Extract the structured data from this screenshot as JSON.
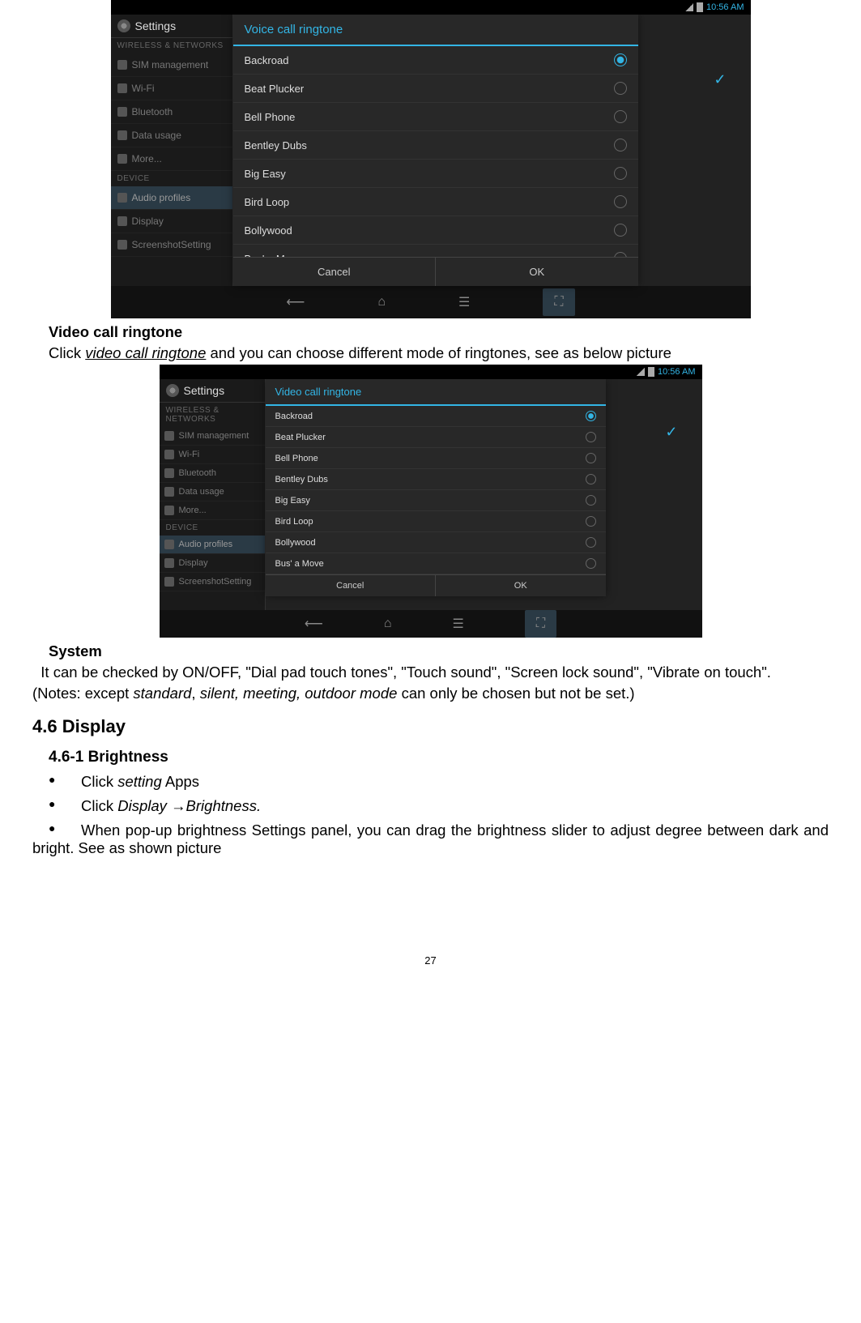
{
  "screenshot_common": {
    "statusbar_time": "10:56 AM",
    "settings_title": "Settings",
    "sidebar_section1": "WIRELESS & NETWORKS",
    "sidebar_items_net": [
      "SIM management",
      "Wi-Fi",
      "Bluetooth",
      "Data usage",
      "More..."
    ],
    "sidebar_section2": "DEVICE",
    "sidebar_items_dev": [
      "Audio profiles",
      "Display",
      "ScreenshotSetting"
    ],
    "ringtone_options": [
      "Backroad",
      "Beat Plucker",
      "Bell Phone",
      "Bentley Dubs",
      "Big Easy",
      "Bird Loop",
      "Bollywood",
      "Bus' a Move"
    ],
    "selected_ringtone": "Backroad",
    "cancel_label": "Cancel",
    "ok_label": "OK"
  },
  "screenshot1": {
    "dialog_title": "Voice call ringtone"
  },
  "screenshot2": {
    "dialog_title": "Video call ringtone"
  },
  "doc": {
    "heading_video": "Video call ringtone",
    "video_text_pre": "Click ",
    "video_text_italic": "video call ringtone",
    "video_text_post": " and you can choose different mode of ringtones, see as below picture",
    "heading_system": "System",
    "system_para": "  It can be checked by ON/OFF, \"Dial pad touch tones\", \"Touch sound\", \"Screen lock sound\", \"Vibrate on touch\".",
    "system_note_pre": "  (Notes: except ",
    "system_note_italic1": "standard",
    "system_note_mid": ", ",
    "system_note_italic2": "silent, meeting, outdoor mode",
    "system_note_post": " can only be chosen but not be set.)",
    "section_display": "4.6 Display",
    "subsection_brightness": "4.6-1 Brightness",
    "bullet1_pre": "Click   ",
    "bullet1_italic": "setting",
    "bullet1_post": " Apps",
    "bullet2_pre": "Click ",
    "bullet2_italic1": "Display",
    "bullet2_arrow": " →",
    "bullet2_italic2": "Brightness.",
    "bullet3": "When pop-up brightness Settings panel, you can drag the brightness slider to adjust degree between dark and bright. See as shown picture",
    "page_number": "27"
  }
}
